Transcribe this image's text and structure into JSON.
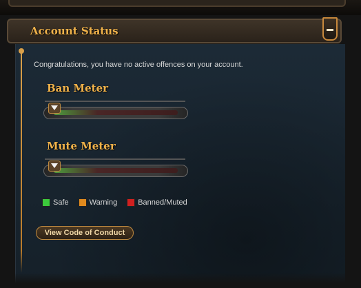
{
  "section": {
    "title": "Account Status",
    "collapse_icon": "minus-icon"
  },
  "main": {
    "info_text": "Congratulations, you have no active offences on your account."
  },
  "meters": [
    {
      "title": "Ban Meter",
      "level": 0
    },
    {
      "title": "Mute Meter",
      "level": 0
    }
  ],
  "legend": [
    {
      "label": "Safe",
      "color": "#3cc93c"
    },
    {
      "label": "Warning",
      "color": "#e08a1e"
    },
    {
      "label": "Banned/Muted",
      "color": "#d02020"
    }
  ],
  "buttons": {
    "view_code": "View Code of Conduct"
  },
  "colors": {
    "accent": "#f0b24a",
    "panel_bg": "#1c2a36"
  }
}
